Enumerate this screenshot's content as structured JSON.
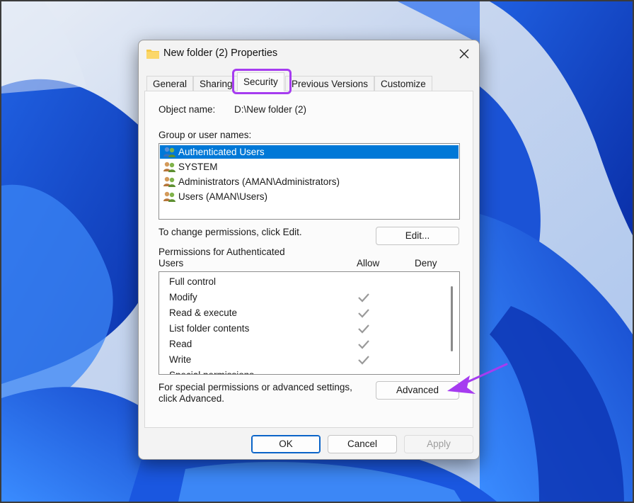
{
  "window": {
    "title": "New folder (2) Properties"
  },
  "tabs": [
    {
      "label": "General"
    },
    {
      "label": "Sharing"
    },
    {
      "label": "Security"
    },
    {
      "label": "Previous Versions"
    },
    {
      "label": "Customize"
    }
  ],
  "active_tab": "Security",
  "security": {
    "object_name_label": "Object name:",
    "object_name_value": "D:\\New folder (2)",
    "group_label": "Group or user names:",
    "users": [
      {
        "name": "Authenticated Users",
        "selected": true
      },
      {
        "name": "SYSTEM",
        "selected": false
      },
      {
        "name": "Administrators (AMAN\\Administrators)",
        "selected": false
      },
      {
        "name": "Users (AMAN\\Users)",
        "selected": false
      }
    ],
    "change_text": "To change permissions, click Edit.",
    "edit_button": "Edit...",
    "permissions_for_line1": "Permissions for Authenticated",
    "permissions_for_line2": "Users",
    "allow_header": "Allow",
    "deny_header": "Deny",
    "permissions": [
      {
        "name": "Full control",
        "allow": false
      },
      {
        "name": "Modify",
        "allow": true
      },
      {
        "name": "Read & execute",
        "allow": true
      },
      {
        "name": "List folder contents",
        "allow": true
      },
      {
        "name": "Read",
        "allow": true
      },
      {
        "name": "Write",
        "allow": true
      },
      {
        "name": "Special permissions",
        "allow": false
      }
    ],
    "advanced_text_line1": "For special permissions or advanced settings,",
    "advanced_text_line2": "click Advanced.",
    "advanced_button": "Advanced"
  },
  "footer": {
    "ok": "OK",
    "cancel": "Cancel",
    "apply": "Apply"
  },
  "colors": {
    "selection": "#0078d7",
    "highlight_annotation": "#a63cf0",
    "check_disabled": "#9a9a9a"
  },
  "icons": {
    "title": "folder-icon",
    "close": "close-icon",
    "user": "users-group-icon",
    "check": "checkmark-icon"
  }
}
